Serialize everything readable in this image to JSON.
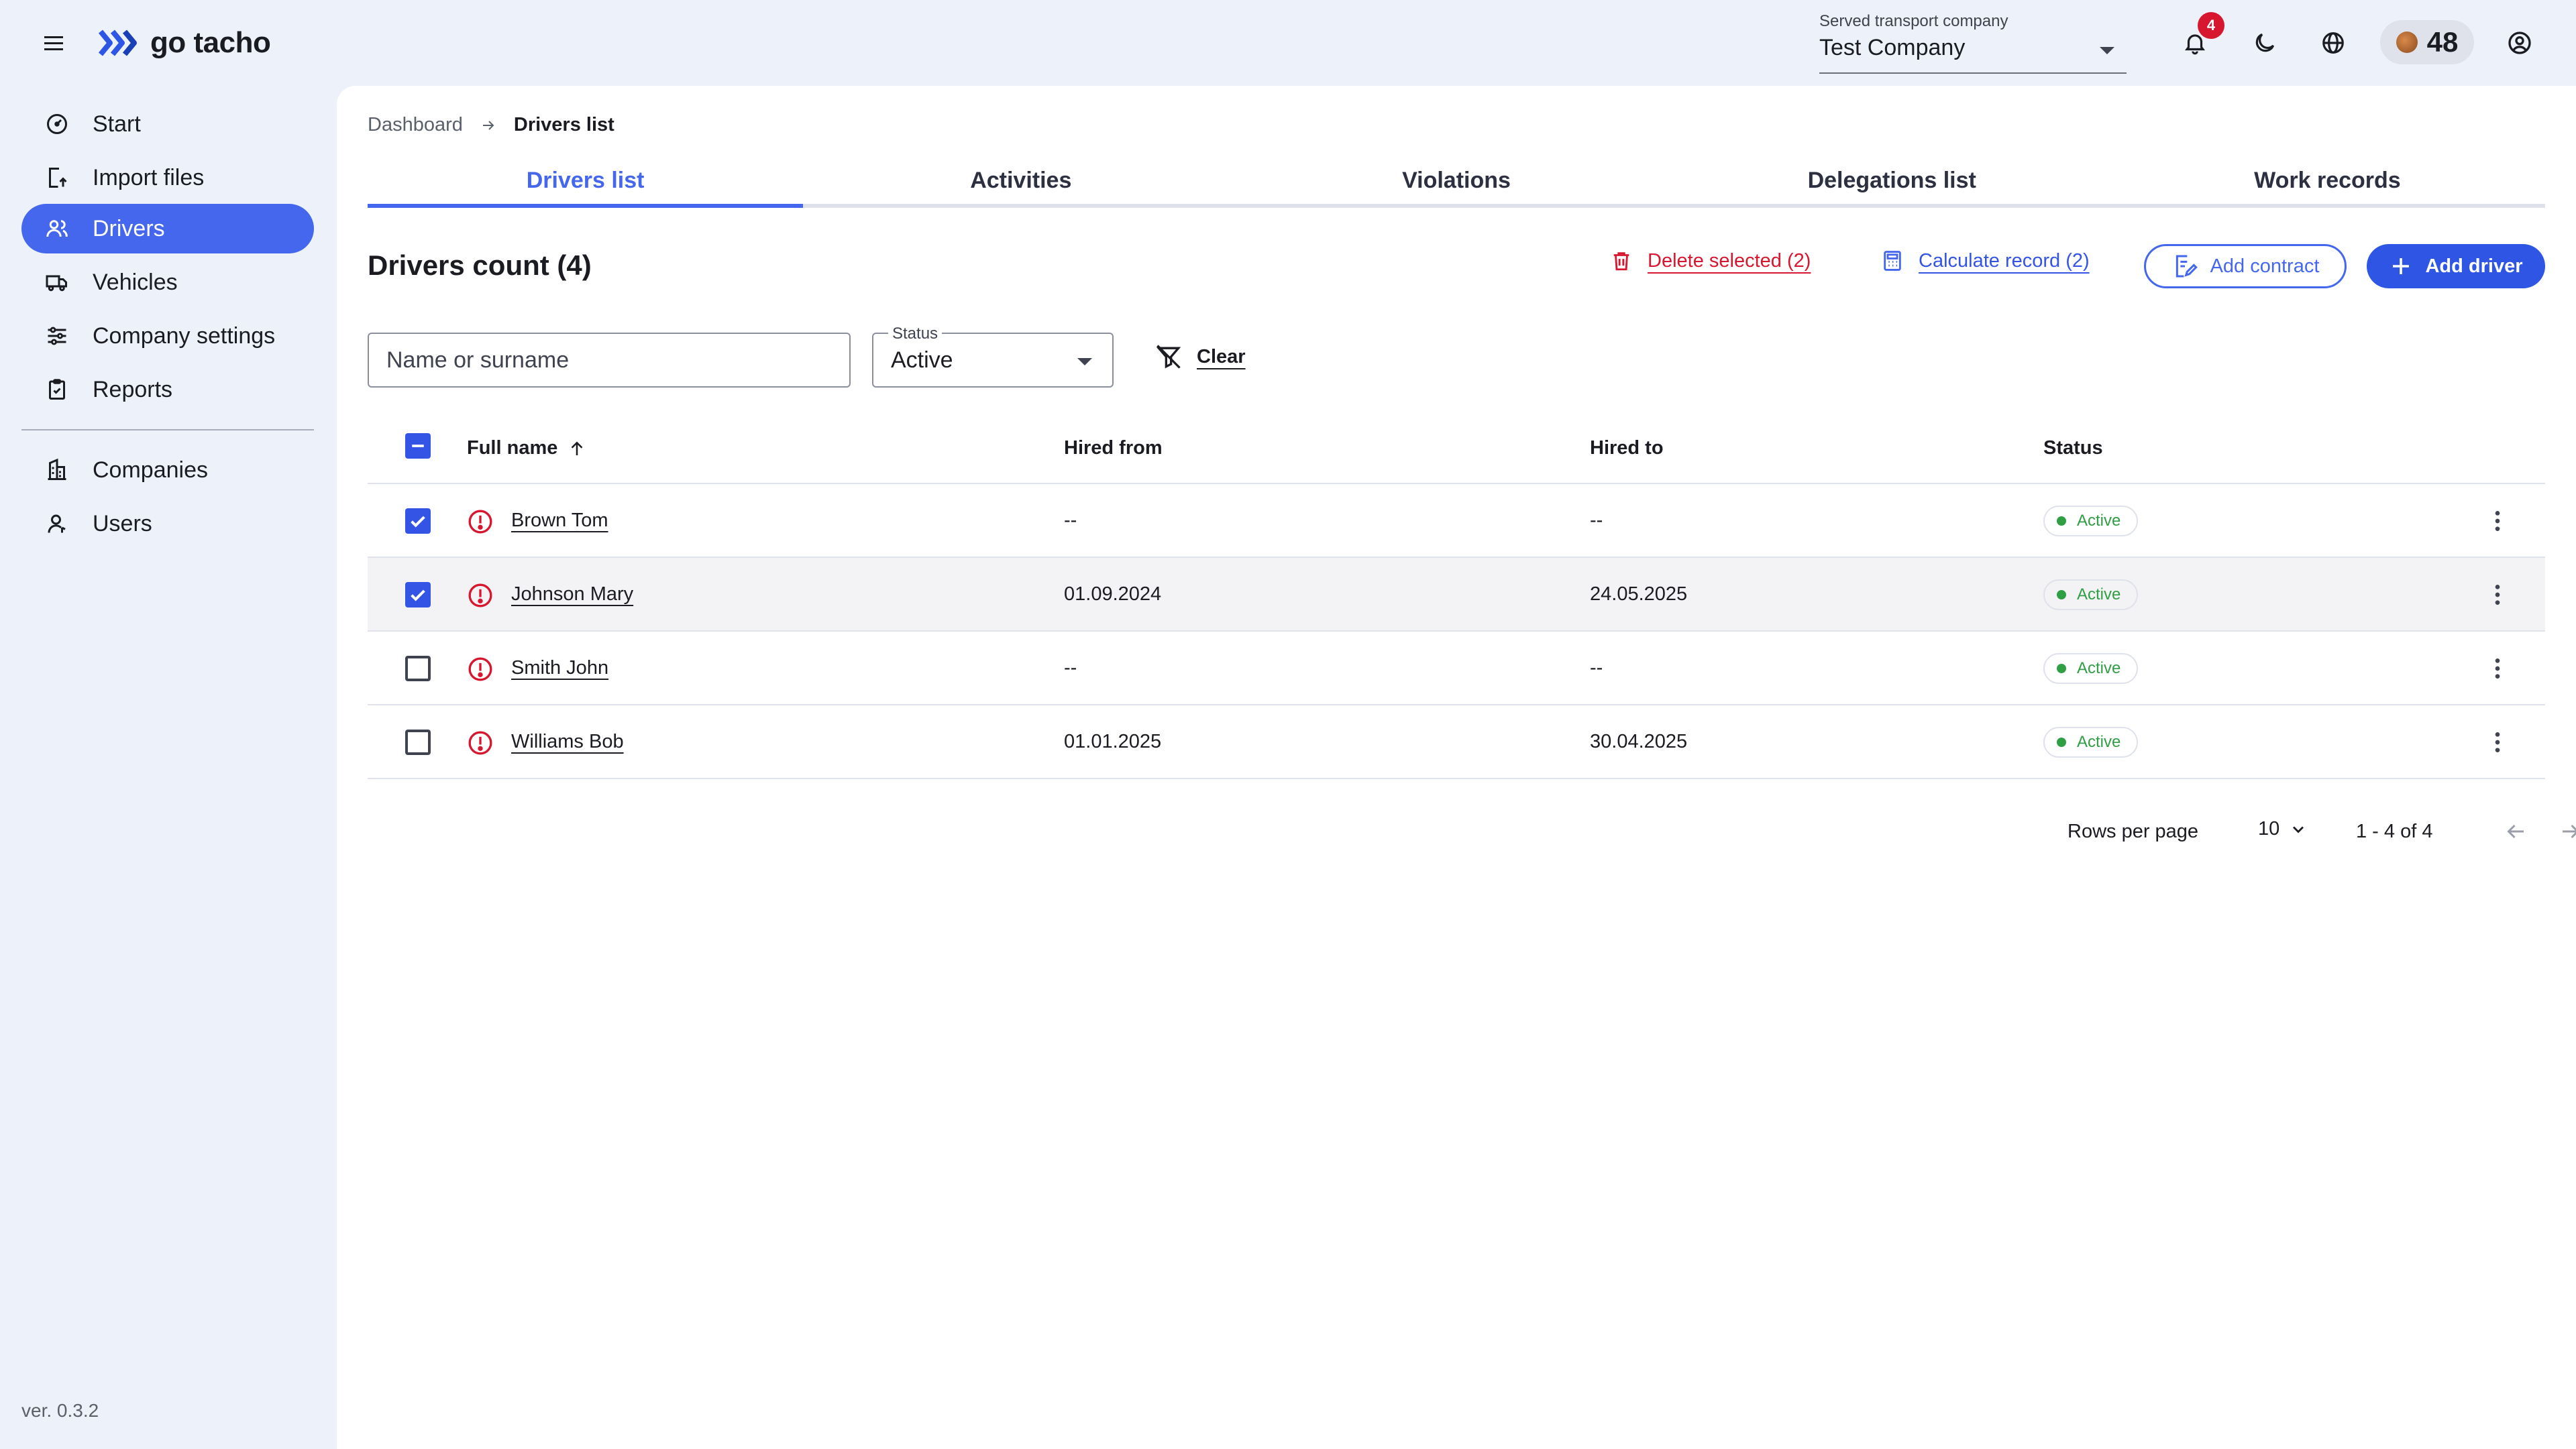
{
  "app": {
    "logo_text": "go tacho"
  },
  "header": {
    "company_label": "Served transport company",
    "company_value": "Test Company",
    "notifications_count": "4",
    "points": "48"
  },
  "sidebar": {
    "items": [
      {
        "label": "Start",
        "icon": "speedometer-icon"
      },
      {
        "label": "Import files",
        "icon": "import-icon"
      },
      {
        "label": "Drivers",
        "icon": "users-icon",
        "active": true
      },
      {
        "label": "Vehicles",
        "icon": "truck-icon"
      },
      {
        "label": "Company settings",
        "icon": "sliders-icon"
      },
      {
        "label": "Reports",
        "icon": "clipboard-icon"
      }
    ],
    "items2": [
      {
        "label": "Companies",
        "icon": "building-icon"
      },
      {
        "label": "Users",
        "icon": "user-icon"
      }
    ],
    "version": "ver. 0.3.2"
  },
  "breadcrumb": {
    "parent": "Dashboard",
    "current": "Drivers list"
  },
  "tabs": [
    "Drivers list",
    "Activities",
    "Violations",
    "Delegations list",
    "Work records"
  ],
  "toolbar": {
    "title": "Drivers count (4)",
    "delete_label": "Delete selected (2)",
    "calculate_label": "Calculate record (2)",
    "add_contract_label": "Add contract",
    "add_driver_label": "Add driver"
  },
  "filters": {
    "search_placeholder": "Name or surname",
    "status_label": "Status",
    "status_value": "Active",
    "clear_label": "Clear"
  },
  "table": {
    "columns": [
      "Full name",
      "Hired from",
      "Hired to",
      "Status"
    ],
    "rows": [
      {
        "name": "Brown Tom",
        "hired_from": "--",
        "hired_to": "--",
        "status": "Active",
        "checked": true
      },
      {
        "name": "Johnson Mary",
        "hired_from": "01.09.2024",
        "hired_to": "24.05.2025",
        "status": "Active",
        "checked": true
      },
      {
        "name": "Smith John",
        "hired_from": "--",
        "hired_to": "--",
        "status": "Active",
        "checked": false
      },
      {
        "name": "Williams Bob",
        "hired_from": "01.01.2025",
        "hired_to": "30.04.2025",
        "status": "Active",
        "checked": false
      }
    ]
  },
  "pagination": {
    "rows_per_page_label": "Rows per page",
    "rows_per_page_value": "10",
    "range": "1 - 4 of 4"
  },
  "colors": {
    "accent": "#4467ee",
    "danger": "#d7172f",
    "success": "#2f9e44",
    "sidebar_bg": "#edf1f9"
  }
}
